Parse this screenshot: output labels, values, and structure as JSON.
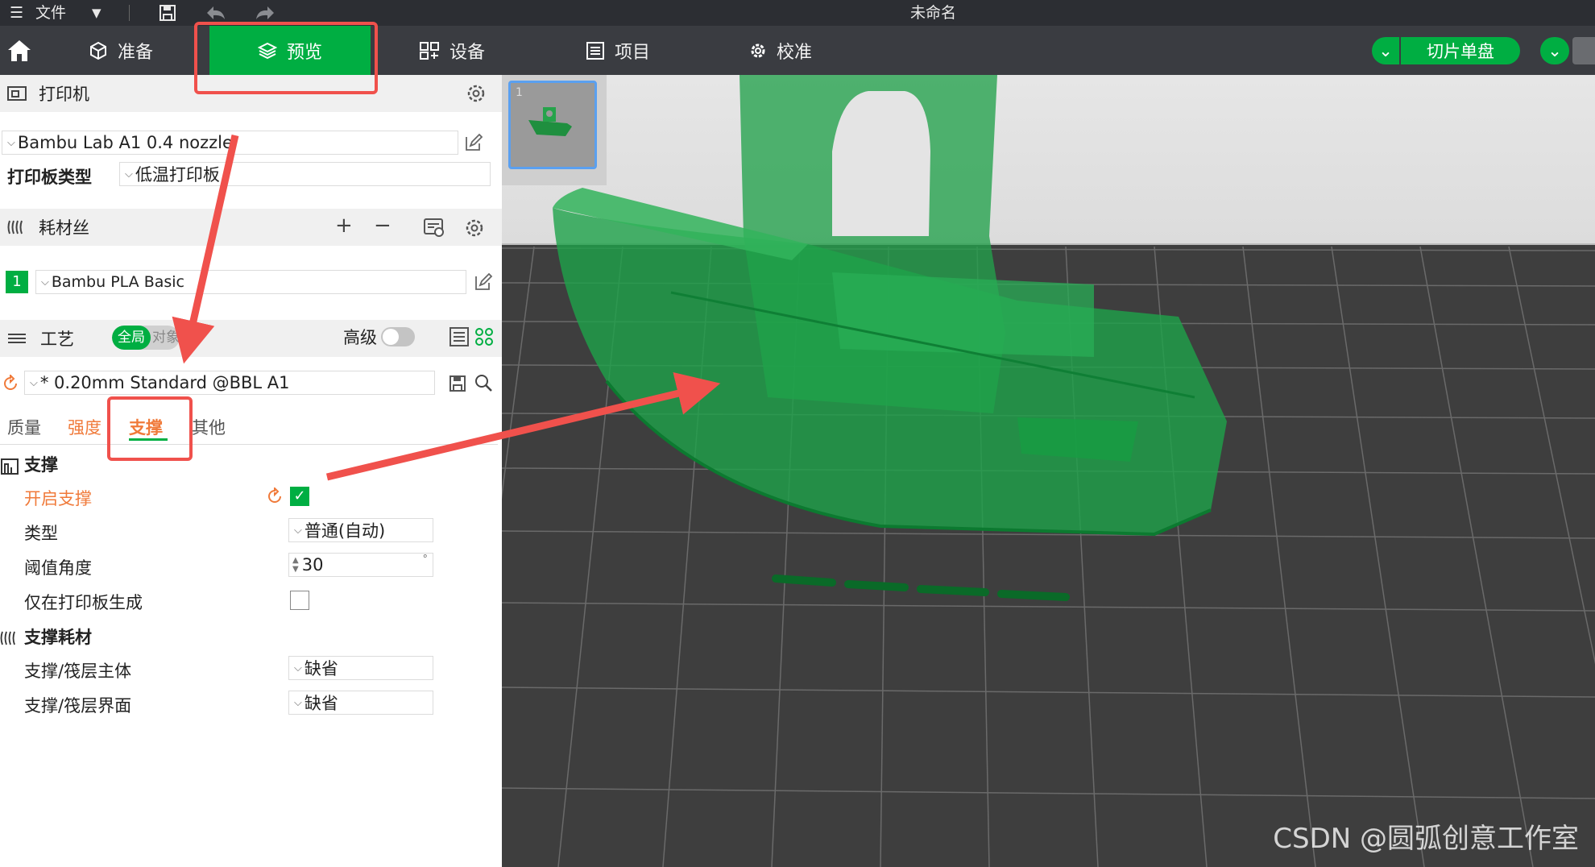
{
  "titlebar": {
    "menu_label": "文件",
    "doc_title": "未命名"
  },
  "nav": {
    "tabs": [
      {
        "label": "准备"
      },
      {
        "label": "预览"
      },
      {
        "label": "设备"
      },
      {
        "label": "项目"
      },
      {
        "label": "校准"
      }
    ],
    "slice_label": "切片单盘"
  },
  "printer": {
    "header": "打印机",
    "preset": "Bambu Lab A1 0.4 nozzle",
    "plate_type_label": "打印板类型",
    "plate_type_value": "低温打印板"
  },
  "filament": {
    "header": "耗材丝",
    "slot_number": "1",
    "preset": "Bambu PLA Basic",
    "slot_color": "#00ae42"
  },
  "process": {
    "header": "工艺",
    "toggle_global": "全局",
    "toggle_object": "对象",
    "advanced_label": "高级",
    "preset": "* 0.20mm Standard @BBL A1"
  },
  "subtabs": [
    {
      "label": "质量"
    },
    {
      "label": "强度"
    },
    {
      "label": "支撑"
    },
    {
      "label": "其他"
    }
  ],
  "support": {
    "group_title": "支撑",
    "enable_label": "开启支撑",
    "enable_checked": true,
    "type_label": "类型",
    "type_value": "普通(自动)",
    "threshold_label": "阈值角度",
    "threshold_value": "30",
    "threshold_unit": "°",
    "on_plate_only_label": "仅在打印板生成",
    "on_plate_only_checked": false
  },
  "support_filament": {
    "group_title": "支撑耗材",
    "base_label": "支撑/筏层主体",
    "base_value": "缺省",
    "interface_label": "支撑/筏层界面",
    "interface_value": "缺省"
  },
  "thumbnail": {
    "plate_number": "1"
  },
  "watermark": "CSDN @圆弧创意工作室",
  "colors": {
    "accent": "#00ae42",
    "highlight_orange": "#f07a3a",
    "annotation_red": "#f0514c"
  }
}
